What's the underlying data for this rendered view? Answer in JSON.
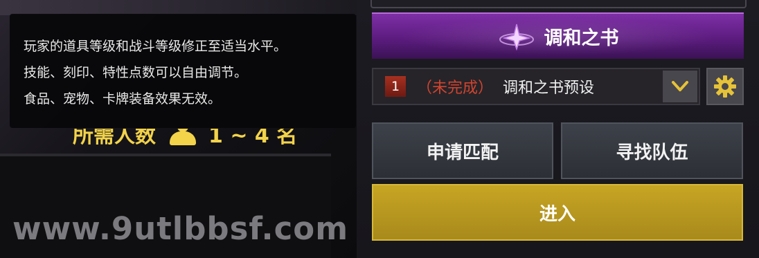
{
  "tooltip": {
    "line1": "玩家的道具等级和战斗等级修正至适当水平。",
    "line2": "技能、刻印、特性点数可以自由调节。",
    "line3": "食品、宠物、卡牌装备效果无效。"
  },
  "required": {
    "label": "所需人数",
    "value": "1 ~ 4 名"
  },
  "book": {
    "title": "调和之书",
    "icon": "four-point-star-icon"
  },
  "preset": {
    "number": "1",
    "status": "（未完成）",
    "name": "调和之书预设",
    "dropdown_icon": "chevron-down-icon",
    "settings_icon": "gear-icon"
  },
  "buttons": {
    "match": "申请匹配",
    "find_team": "寻找队伍",
    "enter": "进入"
  },
  "watermark": "www.9utlbbsf.com",
  "colors": {
    "accent_purple": "#7e2fa6",
    "enter_gold": "#c7a523",
    "status_red": "#d2442e",
    "highlight_yellow": "#f2d34a"
  }
}
